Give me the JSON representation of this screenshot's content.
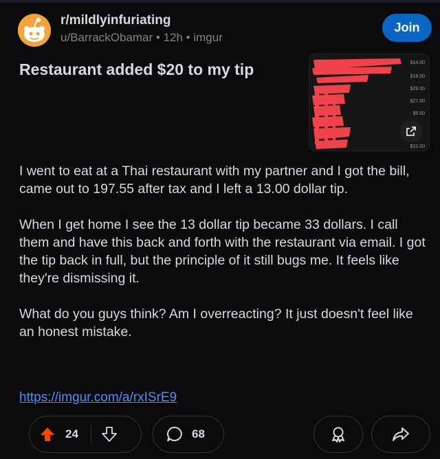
{
  "post": {
    "subreddit": "r/mildlyinfuriating",
    "author": "u/BarrackObamar",
    "age": "12h",
    "source": "imgur",
    "separator": " • ",
    "join_label": "Join",
    "title": "Restaurant added $20 to my tip",
    "body": [
      "I went to eat at a Thai restaurant with my partner and I got the bill, came out to 197.55 after tax and I left a 13.00 dollar tip.",
      "When I get home I see the 13 dollar tip became 33 dollars. I call them and have this back and forth with the restaurant via email. I got the tip back in full, but the principle of it still bugs me. It feels like they're dismissing it.",
      "What do you guys think? Am I overreacting? It just doesn't feel like an honest mistake."
    ],
    "link": "https://imgur.com/a/rxISrE9",
    "thumbnail_amounts": [
      "$14.00",
      "$18.00",
      "$29.00",
      "$27.00",
      "$5.00",
      "$31.00"
    ]
  },
  "actions": {
    "upvotes": "24",
    "comments": "68"
  },
  "colors": {
    "background": "#0b0b0d",
    "accent_join": "#0a66c2",
    "upvote": "#ff4500",
    "link": "#4f8ff7",
    "redaction": "#f0424a"
  }
}
